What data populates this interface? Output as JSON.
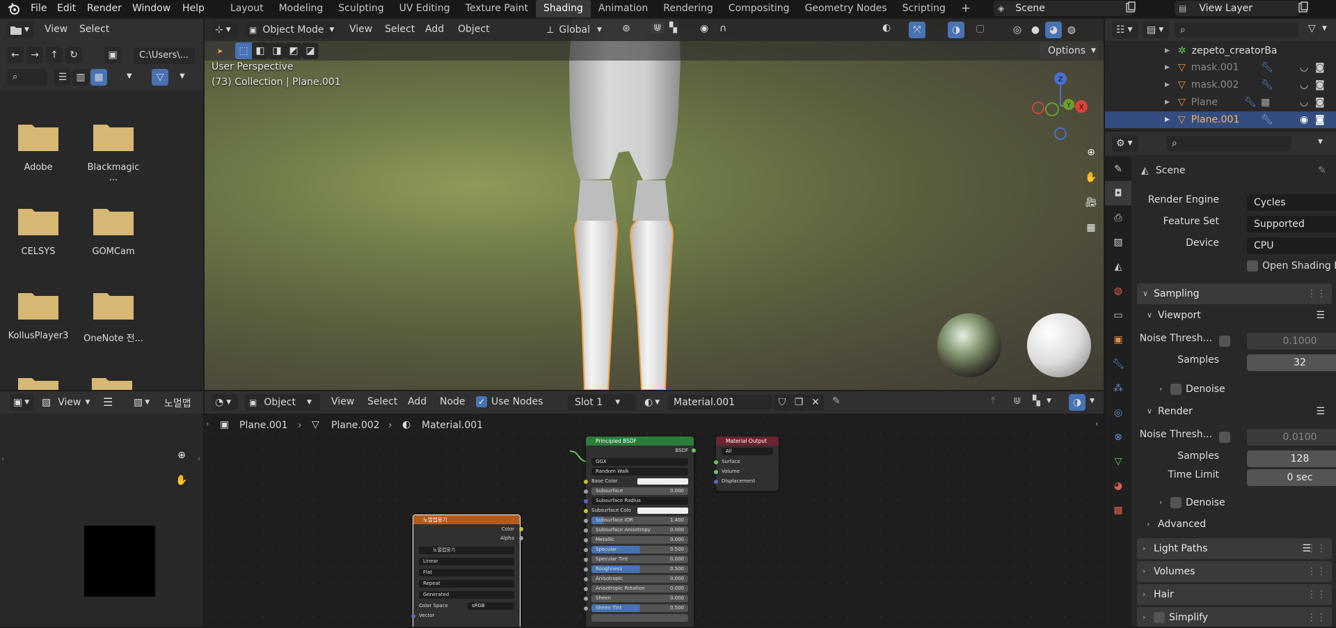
{
  "menu": {
    "items": [
      "File",
      "Edit",
      "Render",
      "Window",
      "Help"
    ],
    "workspaces": [
      "Layout",
      "Modeling",
      "Sculpting",
      "UV Editing",
      "Texture Paint",
      "Shading",
      "Animation",
      "Rendering",
      "Compositing",
      "Geometry Nodes",
      "Scripting"
    ],
    "active_workspace": "Shading",
    "add_tab": "+",
    "scene": "Scene",
    "view_layer": "View Layer"
  },
  "file_browser": {
    "menus": [
      "View",
      "Select"
    ],
    "path": "C:\\Users\\...",
    "folders": [
      "Adobe",
      "Blackmagic ...",
      "CELSYS",
      "GOMCam",
      "KollusPlayer3",
      "OneNote 전..."
    ]
  },
  "viewport": {
    "mode": "Object Mode",
    "menus": [
      "View",
      "Select",
      "Add",
      "Object"
    ],
    "transform_orientation": "Global",
    "options": "Options",
    "overlay_line1": "User Perspective",
    "overlay_line2": "(73) Collection | Plane.001",
    "gizmo": {
      "z": "Z",
      "y": "Y",
      "x": "X"
    }
  },
  "outliner": {
    "items": [
      {
        "name": "zepeto_creatorBa",
        "selected": false
      },
      {
        "name": "mask.001",
        "selected": false
      },
      {
        "name": "mask.002",
        "selected": false
      },
      {
        "name": "Plane",
        "selected": false
      },
      {
        "name": "Plane.001",
        "selected": true
      }
    ]
  },
  "properties": {
    "scene": "Scene",
    "render_engine_label": "Render Engine",
    "render_engine": "Cycles",
    "feature_set_label": "Feature Set",
    "feature_set": "Supported",
    "device_label": "Device",
    "device": "CPU",
    "osl_label": "Open Shading Lang...",
    "sampling": "Sampling",
    "viewport": "Viewport",
    "noise_threshold_label": "Noise Thresh...",
    "viewport_noise_threshold": "0.1000",
    "samples_label": "Samples",
    "viewport_samples": "32",
    "denoise_label": "Denoise",
    "render": "Render",
    "render_noise_threshold": "0.0100",
    "render_samples": "128",
    "time_limit_label": "Time Limit",
    "time_limit": "0 sec",
    "advanced": "Advanced",
    "light_paths": "Light Paths",
    "volumes": "Volumes",
    "hair": "Hair",
    "simplify": "Simplify"
  },
  "image_editor": {
    "view": "View",
    "image_name": "노멀맵"
  },
  "shader_editor": {
    "type": "Object",
    "menus": [
      "View",
      "Select",
      "Add",
      "Node"
    ],
    "use_nodes": "Use Nodes",
    "slot": "Slot 1",
    "material": "Material.001",
    "breadcrumb": [
      "Plane.001",
      "Plane.002",
      "Material.001"
    ],
    "principled": {
      "title": "Principled BSDF",
      "output": "BSDF",
      "distribution": "GGX",
      "subsurface_method": "Random Walk",
      "inputs": [
        {
          "name": "Base Color",
          "value": ""
        },
        {
          "name": "Subsurface",
          "value": "0.000"
        },
        {
          "name": "Subsurface Radius",
          "value": ""
        },
        {
          "name": "Subsurface Colo",
          "value": ""
        },
        {
          "name": "Subsurface IOR",
          "value": "1.400"
        },
        {
          "name": "Subsurface Anisotropy",
          "value": "0.000"
        },
        {
          "name": "Metallic",
          "value": "0.000"
        },
        {
          "name": "Specular",
          "value": "0.500"
        },
        {
          "name": "Specular Tint",
          "value": "0.000"
        },
        {
          "name": "Roughness",
          "value": "0.500"
        },
        {
          "name": "Anisotropic",
          "value": "0.000"
        },
        {
          "name": "Anisotropic Rotation",
          "value": "0.000"
        },
        {
          "name": "Sheen",
          "value": "0.000"
        },
        {
          "name": "Sheen Tint",
          "value": "0.500"
        }
      ]
    },
    "material_output": {
      "title": "Material Output",
      "target": "All",
      "inputs": [
        "Surface",
        "Volume",
        "Displacement"
      ]
    },
    "image_texture": {
      "title": "노멀맵뭉기",
      "outputs": [
        "Color",
        "Alpha"
      ],
      "image": "노멀맵뭉기",
      "interpolation": "Linear",
      "projection": "Flat",
      "extension": "Repeat",
      "source": "Generated",
      "color_space_label": "Color Space",
      "color_space": "sRGB",
      "vector": "Vector"
    }
  },
  "colors": {
    "accent_blue": "#4772b3",
    "selection_orange": "#f5a142",
    "node_green": "#2b7d3a",
    "node_red": "#6b2430",
    "node_orange": "#b35b1e",
    "folder": "#d6b774"
  }
}
